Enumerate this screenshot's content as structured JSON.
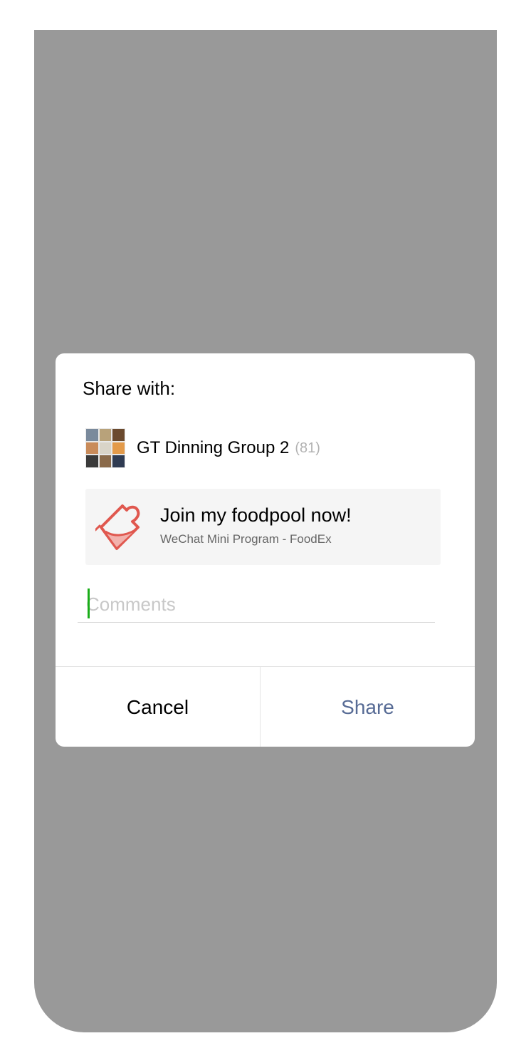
{
  "dialog": {
    "title": "Share with:",
    "recipient": {
      "name": "GT Dinning Group 2",
      "count": "(81)",
      "avatar_tiles": [
        "#7a8a9c",
        "#b8a27a",
        "#6b4a2e",
        "#c98b5a",
        "#d9d4c8",
        "#e39a4a",
        "#3a3a3a",
        "#8a6a4a",
        "#2f3b52"
      ]
    },
    "card": {
      "title": "Join my foodpool now!",
      "subtitle": "WeChat Mini Program - FoodEx",
      "icon": "puzzle-bowl-logo-icon",
      "icon_color": "#e0584f"
    },
    "comments": {
      "placeholder": "Comments",
      "value": ""
    },
    "buttons": {
      "cancel_label": "Cancel",
      "share_label": "Share"
    },
    "colors": {
      "share_text": "#576b95",
      "caret": "#1aad19",
      "overlay": "#999999"
    }
  }
}
